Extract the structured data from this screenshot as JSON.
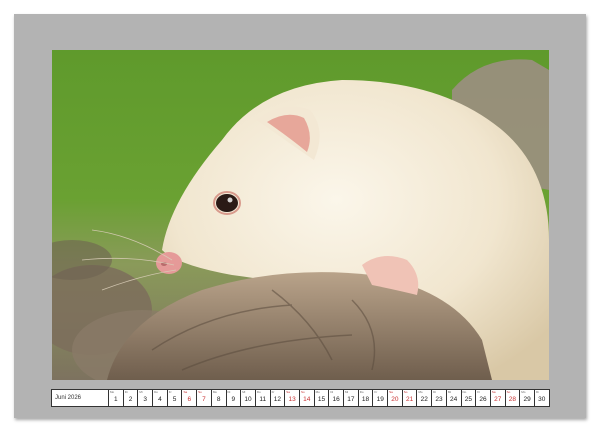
{
  "calendar": {
    "month_label": "Juni 2026",
    "days": [
      {
        "wd": "Mo",
        "d": "1",
        "weekend": false
      },
      {
        "wd": "Di",
        "d": "2",
        "weekend": false
      },
      {
        "wd": "Mi",
        "d": "3",
        "weekend": false
      },
      {
        "wd": "Do",
        "d": "4",
        "weekend": false
      },
      {
        "wd": "Fr",
        "d": "5",
        "weekend": false
      },
      {
        "wd": "Sa",
        "d": "6",
        "weekend": true
      },
      {
        "wd": "So",
        "d": "7",
        "weekend": true
      },
      {
        "wd": "Mo",
        "d": "8",
        "weekend": false
      },
      {
        "wd": "Di",
        "d": "9",
        "weekend": false
      },
      {
        "wd": "Mi",
        "d": "10",
        "weekend": false
      },
      {
        "wd": "Do",
        "d": "11",
        "weekend": false
      },
      {
        "wd": "Fr",
        "d": "12",
        "weekend": false
      },
      {
        "wd": "Sa",
        "d": "13",
        "weekend": true
      },
      {
        "wd": "So",
        "d": "14",
        "weekend": true
      },
      {
        "wd": "Mo",
        "d": "15",
        "weekend": false
      },
      {
        "wd": "Di",
        "d": "16",
        "weekend": false
      },
      {
        "wd": "Mi",
        "d": "17",
        "weekend": false
      },
      {
        "wd": "Do",
        "d": "18",
        "weekend": false
      },
      {
        "wd": "Fr",
        "d": "19",
        "weekend": false
      },
      {
        "wd": "Sa",
        "d": "20",
        "weekend": true
      },
      {
        "wd": "So",
        "d": "21",
        "weekend": true
      },
      {
        "wd": "Mo",
        "d": "22",
        "weekend": false
      },
      {
        "wd": "Di",
        "d": "23",
        "weekend": false
      },
      {
        "wd": "Mi",
        "d": "24",
        "weekend": false
      },
      {
        "wd": "Do",
        "d": "25",
        "weekend": false
      },
      {
        "wd": "Fr",
        "d": "26",
        "weekend": false
      },
      {
        "wd": "Sa",
        "d": "27",
        "weekend": true
      },
      {
        "wd": "So",
        "d": "28",
        "weekend": true
      },
      {
        "wd": "Mo",
        "d": "29",
        "weekend": false
      },
      {
        "wd": "Di",
        "d": "30",
        "weekend": false
      }
    ]
  }
}
